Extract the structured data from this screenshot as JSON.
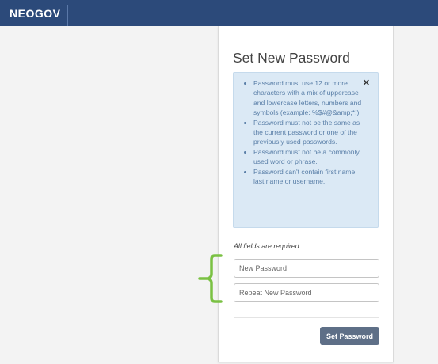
{
  "header": {
    "logo_text": "NEOGOV",
    "bg_color": "#2c4a7a"
  },
  "card": {
    "title": "Set New Password",
    "close_icon": "close-icon",
    "rules": [
      "Password must use 12 or more characters with a mix of uppercase and lowercase letters, numbers and symbols (example: %$#@&amp;*!).",
      "Password must not be the same as the current password or one of the previously used passwords.",
      "Password must not be a commonly used word or phrase.",
      "Password can't contain first name, last name or username."
    ],
    "required_note": "All fields are required",
    "new_password_placeholder": "New Password",
    "repeat_password_placeholder": "Repeat New Password",
    "submit_label": "Set Password",
    "button_color": "#5e6f87",
    "rules_bg_color": "#dbe9f5"
  },
  "annotation": {
    "bracket_color": "#7ac143"
  }
}
